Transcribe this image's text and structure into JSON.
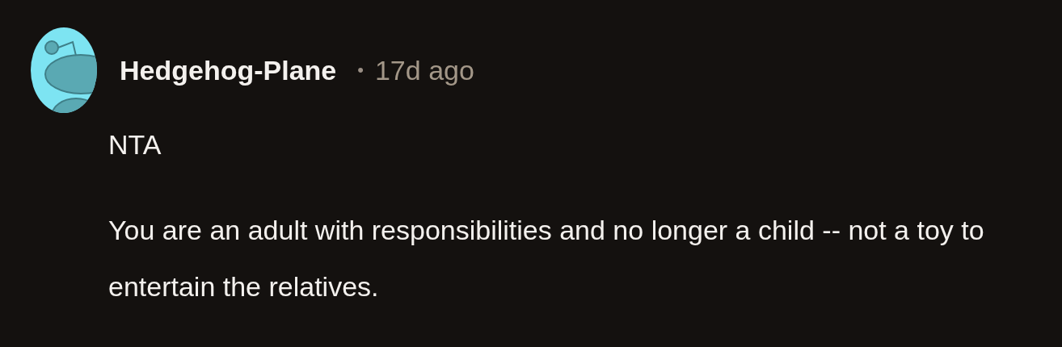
{
  "comment": {
    "author": "Hedgehog-Plane",
    "separator": "•",
    "time": "17d ago",
    "paragraphs": [
      "NTA",
      "You are an adult with responsibilities and no longer a child -- not a toy to entertain the relatives."
    ]
  }
}
